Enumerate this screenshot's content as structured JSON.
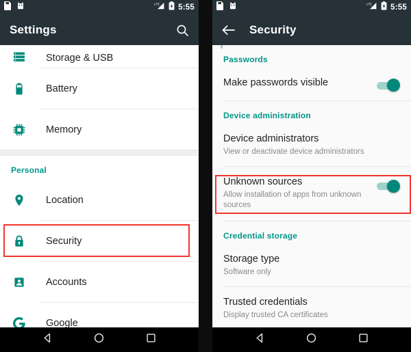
{
  "left_phone": {
    "status_bar": {
      "notification_icons": [
        "sim-card-icon",
        "android-robot-icon"
      ],
      "network_label": "LTE",
      "signal_icon": "signal-bars-icon",
      "battery_icon": "battery-charging-icon",
      "time": "5:55"
    },
    "app_bar": {
      "title": "Settings",
      "search_icon": "search-icon"
    },
    "list": [
      {
        "icon": "storage-icon",
        "label": "Storage & USB",
        "partial": true
      },
      {
        "icon": "battery-icon",
        "label": "Battery"
      },
      {
        "icon": "memory-icon",
        "label": "Memory"
      }
    ],
    "section_header": "Personal",
    "list2": [
      {
        "icon": "location-pin-icon",
        "label": "Location"
      },
      {
        "icon": "lock-icon",
        "label": "Security",
        "highlighted": true
      },
      {
        "icon": "account-icon",
        "label": "Accounts"
      },
      {
        "icon": "google-g-icon",
        "label": "Google"
      }
    ]
  },
  "right_phone": {
    "status_bar": {
      "notification_icons": [
        "sim-card-icon",
        "android-robot-icon"
      ],
      "network_label": "LTE",
      "signal_icon": "signal-bars-icon",
      "battery_icon": "battery-charging-icon",
      "time": "5:55"
    },
    "app_bar": {
      "back_icon": "back-arrow-icon",
      "title": "Security"
    },
    "sections": [
      {
        "header": "Passwords",
        "rows": [
          {
            "title": "Make passwords visible",
            "subtitle": "",
            "toggle": "on"
          }
        ]
      },
      {
        "header": "Device administration",
        "rows": [
          {
            "title": "Device administrators",
            "subtitle": "View or deactivate device administrators",
            "toggle": null
          },
          {
            "title": "Unknown sources",
            "subtitle": "Allow installation of apps from unknown sources",
            "toggle": "on",
            "highlighted": true
          }
        ]
      },
      {
        "header": "Credential storage",
        "rows": [
          {
            "title": "Storage type",
            "subtitle": "Software only",
            "toggle": null
          },
          {
            "title": "Trusted credentials",
            "subtitle": "Display trusted CA certificates",
            "toggle": null
          }
        ]
      }
    ]
  },
  "nav_bar": {
    "buttons": [
      {
        "icon": "back-triangle-icon"
      },
      {
        "icon": "home-circle-icon"
      },
      {
        "icon": "recents-square-icon"
      }
    ]
  },
  "colors": {
    "accent_teal": "#009688",
    "toggle_thumb": "#00897b",
    "toggle_track": "#9ed3cd",
    "appbar": "#263238",
    "highlight_red": "#f2352e",
    "primary_text": "#212121",
    "secondary_text": "#8a8a8a"
  }
}
